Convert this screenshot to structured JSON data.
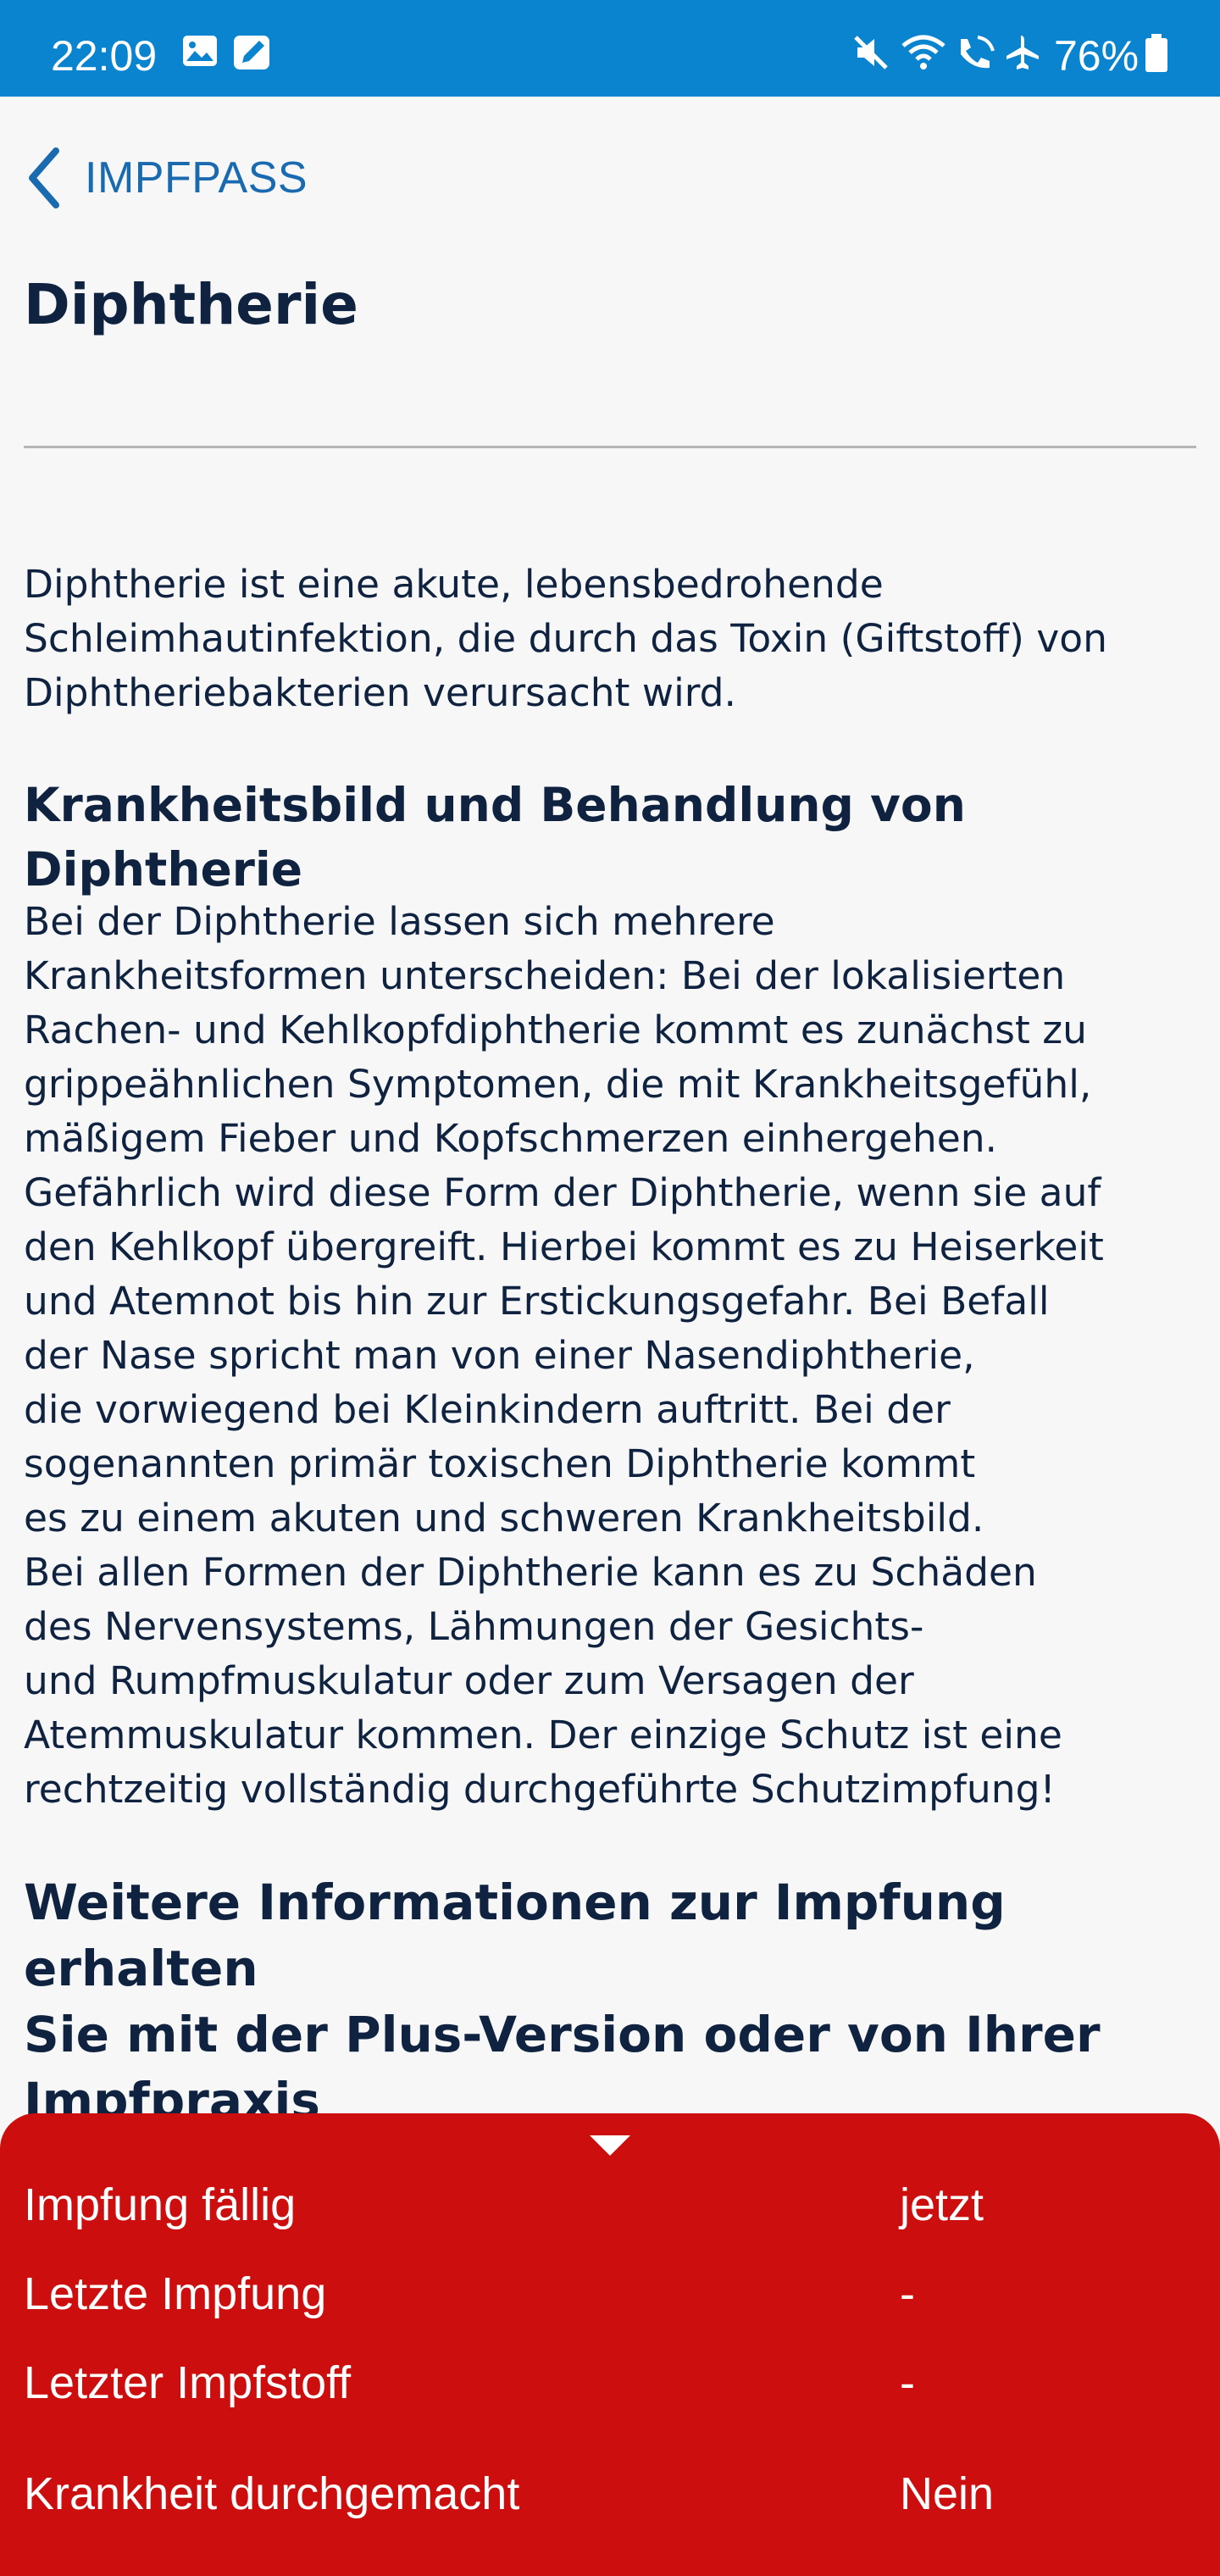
{
  "status_bar": {
    "time": "22:09",
    "battery": "76%",
    "icons_left": [
      "gallery-icon",
      "edit-icon"
    ],
    "icons_right": [
      "mute-icon",
      "wifi-icon",
      "wifi-calling-icon",
      "airplane-icon",
      "battery-icon"
    ],
    "background": "#0b84cf"
  },
  "nav": {
    "back_label": "IMPFPASS"
  },
  "page": {
    "title": "Diphtherie",
    "intro": "Diphtherie ist eine akute, lebensbedrohende\nSchleimhautinfektion, die durch das Toxin (Giftstoff) von\nDiphtheriebakterien verursacht wird.",
    "section_heading": "Krankheitsbild und Behandlung von Diphtherie",
    "section_body": "Bei der Diphtherie lassen sich mehrere\nKrankheitsformen unterscheiden: Bei der lokalisierten\nRachen- und Kehlkopfdiphtherie kommt es zunächst zu\ngrippeähnlichen Symptomen, die mit Krankheitsgefühl,\nmäßigem Fieber und Kopfschmerzen einhergehen.\nGefährlich wird diese Form der Diphtherie, wenn sie auf\nden Kehlkopf übergreift. Hierbei kommt es zu Heiserkeit\nund Atemnot bis hin zur Erstickungsgefahr. Bei Befall\nder Nase spricht man von einer Nasendiphtherie,\ndie vorwiegend bei Kleinkindern auftritt. Bei der\nsogenannten primär toxischen Diphtherie kommt\nes zu einem akuten und schweren Krankheitsbild.\nBei allen Formen der Diphtherie kann es zu Schäden\ndes Nervensystems, Lähmungen der Gesichts-\nund Rumpfmuskulatur oder zum Versagen der\nAtemmuskulatur kommen. Der einzige Schutz ist eine\nrechtzeitig vollständig durchgeführte Schutzimpfung!",
    "plus_heading": "Weitere Informationen zur Impfung erhalten\nSie mit der Plus-Version oder von Ihrer\nImpfpraxis"
  },
  "info_panel": {
    "background": "#cc0e0e",
    "handle_icon": "chevron-down-icon",
    "rows": [
      {
        "label": "Impfung fällig",
        "value": "jetzt"
      },
      {
        "label": "Letzte Impfung",
        "value": "-"
      },
      {
        "label": "Letzter Impfstoff",
        "value": "-"
      },
      {
        "label": "Krankheit durchgemacht",
        "value": "Nein"
      }
    ]
  }
}
